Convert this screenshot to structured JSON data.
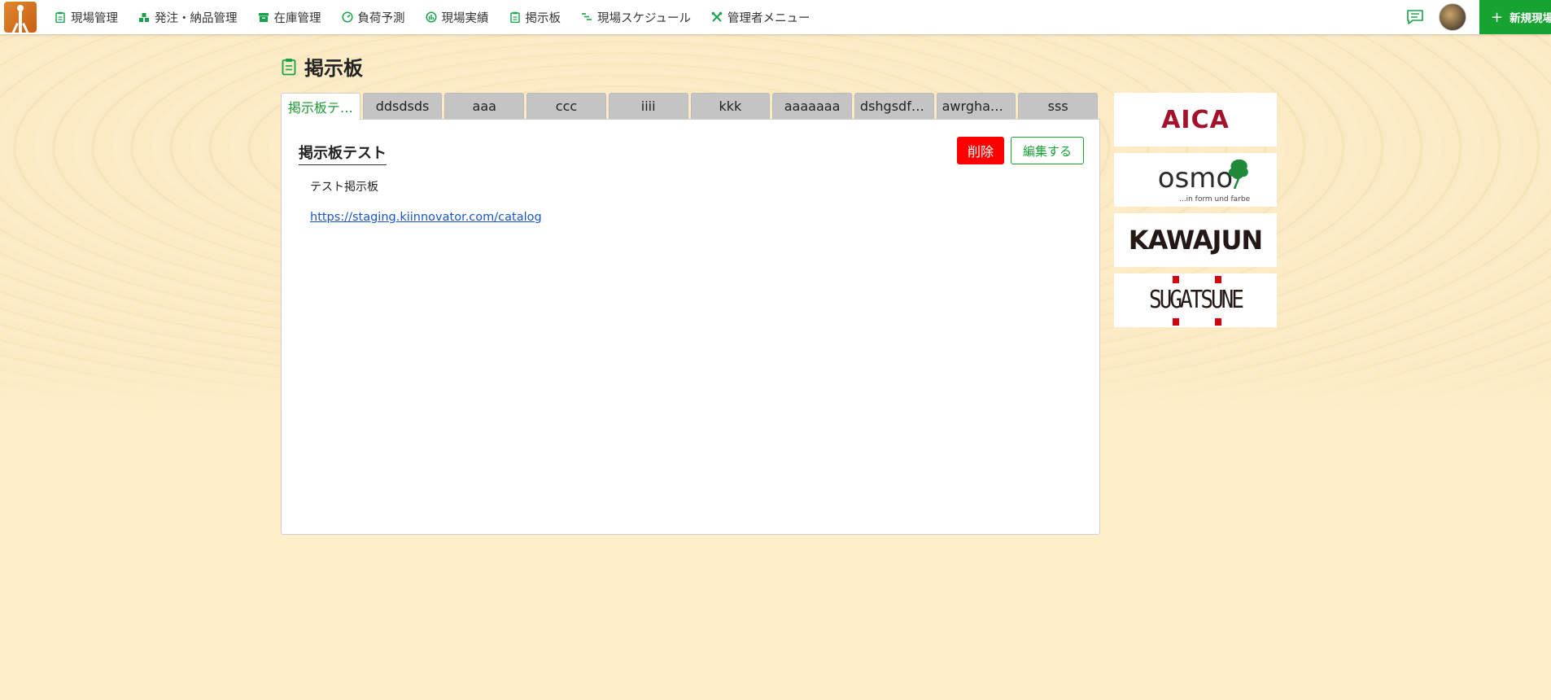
{
  "nav": {
    "items": [
      {
        "label": "現場管理",
        "icon": "clipboard-icon"
      },
      {
        "label": "発注・納品管理",
        "icon": "order-icon"
      },
      {
        "label": "在庫管理",
        "icon": "box-icon"
      },
      {
        "label": "負荷予測",
        "icon": "gauge-icon"
      },
      {
        "label": "現場実績",
        "icon": "chart-icon"
      },
      {
        "label": "掲示板",
        "icon": "clipboard-icon"
      },
      {
        "label": "現場スケジュール",
        "icon": "schedule-icon"
      },
      {
        "label": "管理者メニュー",
        "icon": "tools-icon"
      }
    ],
    "new_site_label": "新規現場"
  },
  "page": {
    "title": "掲示板"
  },
  "tabs": [
    {
      "label": "掲示板テ…",
      "active": true
    },
    {
      "label": "ddsdsds",
      "active": false
    },
    {
      "label": "aaa",
      "active": false
    },
    {
      "label": "ccc",
      "active": false
    },
    {
      "label": "iiii",
      "active": false
    },
    {
      "label": "kkk",
      "active": false
    },
    {
      "label": "aaaaaaa",
      "active": false
    },
    {
      "label": "dshgsdfh…",
      "active": false
    },
    {
      "label": "awrghaw…",
      "active": false
    },
    {
      "label": "sss",
      "active": false
    }
  ],
  "post": {
    "title": "掲示板テスト",
    "delete_label": "削除",
    "edit_label": "編集する",
    "body": "テスト掲示板",
    "link": "https://staging.kiinnovator.com/catalog"
  },
  "sponsors": {
    "aica": "AICA",
    "osmo": "osmo",
    "osmo_tagline": "...in form und farbe",
    "kawajun": "KAWAJUN",
    "sugatsune": "SUGATSUNE"
  },
  "colors": {
    "accent": "#17a332",
    "danger": "#ff0000",
    "link": "#1a55c8",
    "background": "#fdefc9"
  }
}
